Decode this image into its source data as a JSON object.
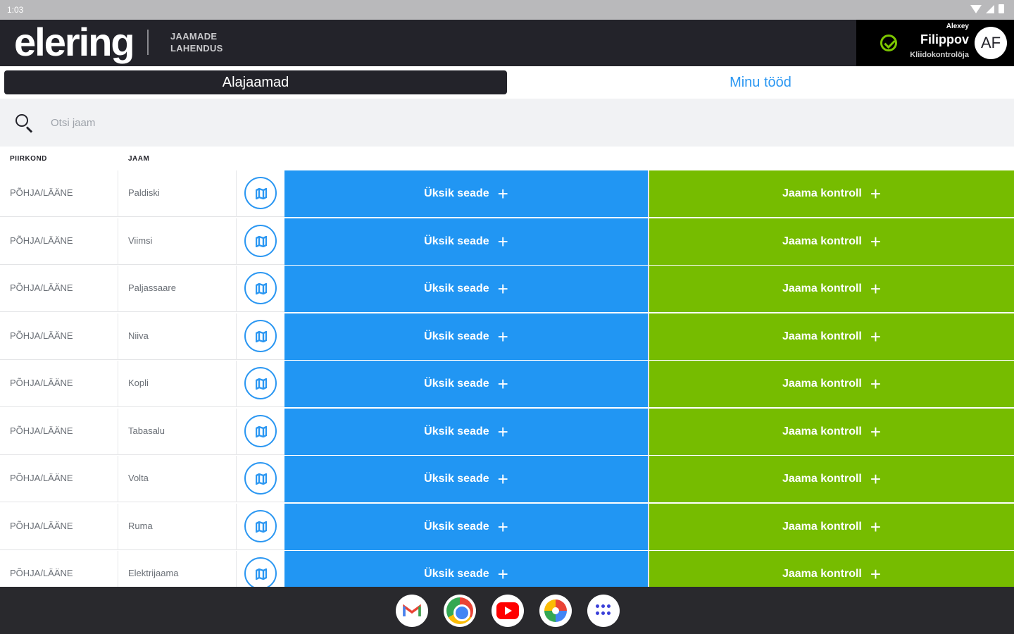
{
  "status_bar": {
    "time": "1:03"
  },
  "header": {
    "logo": "elering",
    "subtitle_line1": "JAAMADE",
    "subtitle_line2": "LAHENDUS",
    "user_first_name": "Alexey",
    "user_last_name": "Filippov",
    "user_role": "Kliidokontrolöja",
    "avatar_initials": "AF"
  },
  "tabs": [
    {
      "label": "Alajaamad",
      "active": true
    },
    {
      "label": "Minu tööd",
      "active": false
    }
  ],
  "search": {
    "placeholder": "Otsi jaam",
    "value": ""
  },
  "columns": {
    "region": "PIIRKOND",
    "station": "JAAM"
  },
  "buttons": {
    "device": "Üksik seade",
    "control": "Jaama kontroll"
  },
  "rows": [
    {
      "region": "PÕHJA/LÄÄNE",
      "station": "Paldiski"
    },
    {
      "region": "PÕHJA/LÄÄNE",
      "station": "Viimsi"
    },
    {
      "region": "PÕHJA/LÄÄNE",
      "station": "Paljassaare"
    },
    {
      "region": "PÕHJA/LÄÄNE",
      "station": "Niiva"
    },
    {
      "region": "PÕHJA/LÄÄNE",
      "station": "Kopli"
    },
    {
      "region": "PÕHJA/LÄÄNE",
      "station": "Tabasalu"
    },
    {
      "region": "PÕHJA/LÄÄNE",
      "station": "Volta"
    },
    {
      "region": "PÕHJA/LÄÄNE",
      "station": "Ruma"
    },
    {
      "region": "PÕHJA/LÄÄNE",
      "station": "Elektrijaama"
    }
  ],
  "colors": {
    "header_bg": "#23232a",
    "device_button": "#2196f3",
    "control_button": "#76bc00",
    "accent_link": "#2b97f2"
  },
  "dock_apps": [
    "gmail-icon",
    "chrome-icon",
    "youtube-icon",
    "photos-icon",
    "app-drawer-icon"
  ]
}
